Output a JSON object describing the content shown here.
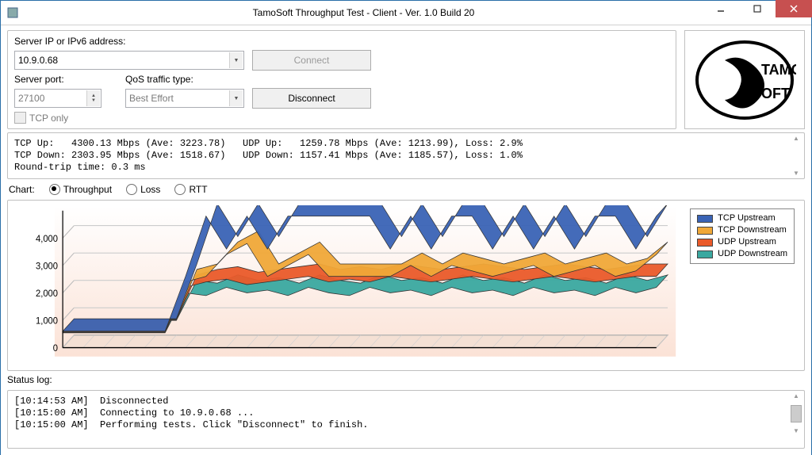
{
  "window": {
    "title": "TamoSoft Throughput Test - Client - Ver. 1.0 Build 20"
  },
  "conn": {
    "ip_label": "Server IP or IPv6  address:",
    "ip_value": "10.9.0.68",
    "port_label": "Server port:",
    "port_value": "27100",
    "qos_label": "QoS traffic type:",
    "qos_value": "Best Effort",
    "connect_label": "Connect",
    "disconnect_label": "Disconnect",
    "tcp_only_label": "TCP only"
  },
  "logo": {
    "line1": "TAMO",
    "line2": "OFT"
  },
  "stats": {
    "l1": "TCP Up:   4300.13 Mbps (Ave: 3223.78)   UDP Up:   1259.78 Mbps (Ave: 1213.99), Loss: 2.9%",
    "l2": "TCP Down: 2303.95 Mbps (Ave: 1518.67)   UDP Down: 1157.41 Mbps (Ave: 1185.57), Loss: 1.0%",
    "l3": "Round-trip time: 0.3 ms"
  },
  "chart_radio": {
    "label": "Chart:",
    "throughput": "Throughput",
    "loss": "Loss",
    "rtt": "RTT"
  },
  "chart_data": {
    "type": "area",
    "ylim": [
      0,
      5000
    ],
    "yticks": [
      0,
      1000,
      2000,
      3000,
      4000
    ],
    "series": [
      {
        "name": "TCP Upstream",
        "color": "#3a63b5",
        "values": [
          600,
          600,
          600,
          600,
          600,
          600,
          2600,
          4800,
          3600,
          4800,
          3600,
          4800,
          4800,
          4800,
          4800,
          4800,
          3600,
          4800,
          3600,
          4800,
          4800,
          3600,
          4800,
          3600,
          4800,
          3600,
          4800,
          4800,
          3600,
          4800
        ]
      },
      {
        "name": "TCP Downstream",
        "color": "#f0a838",
        "values": [
          580,
          580,
          580,
          580,
          580,
          580,
          2400,
          2600,
          3400,
          3800,
          2600,
          3000,
          3400,
          2600,
          2600,
          2600,
          2600,
          3000,
          2600,
          3000,
          2800,
          2600,
          2800,
          3000,
          2600,
          2800,
          3000,
          2600,
          2800,
          3400
        ]
      },
      {
        "name": "UDP Upstream",
        "color": "#ea5a2a",
        "values": [
          560,
          560,
          560,
          560,
          560,
          560,
          2200,
          2400,
          2500,
          2300,
          2400,
          2500,
          2600,
          2400,
          2500,
          2400,
          2600,
          2500,
          2400,
          2500,
          2600,
          2500,
          2400,
          2500,
          2600,
          2500,
          2400,
          2500,
          2600,
          2600
        ]
      },
      {
        "name": "UDP Downstream",
        "color": "#3aa8a0",
        "values": [
          540,
          540,
          540,
          540,
          540,
          540,
          2000,
          1900,
          2200,
          2000,
          2100,
          1900,
          2200,
          2000,
          1900,
          2200,
          2000,
          2100,
          1900,
          2200,
          2000,
          2100,
          1900,
          2200,
          2000,
          2100,
          1900,
          2200,
          2000,
          2200
        ]
      }
    ]
  },
  "legend": {
    "s1": "TCP Upstream",
    "s2": "TCP Downstream",
    "s3": "UDP Upstream",
    "s4": "UDP Downstream"
  },
  "log": {
    "label": "Status log:",
    "l1": "[10:14:53 AM]  Disconnected",
    "l2": "[10:15:00 AM]  Connecting to 10.9.0.68 ...",
    "l3": "[10:15:00 AM]  Performing tests. Click \"Disconnect\" to finish."
  }
}
